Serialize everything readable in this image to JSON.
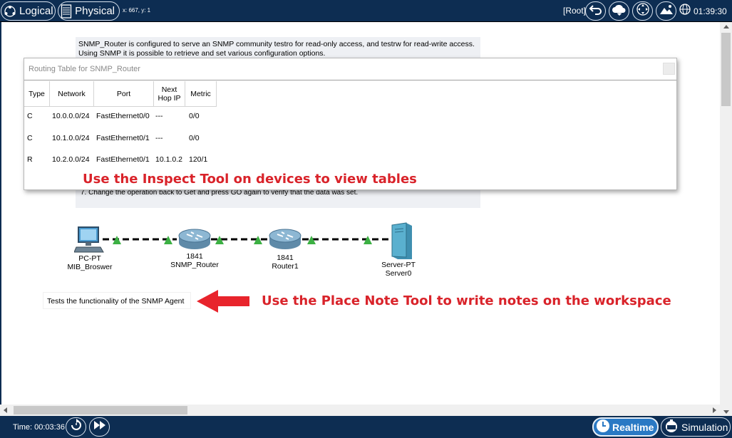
{
  "topbar": {
    "logical_label": "Logical",
    "physical_label": "Physical",
    "coords": "x: 667, y: 1",
    "root_label": "[Root]",
    "clock": "01:39:30"
  },
  "workspace": {
    "note_lines": [
      "SNMP_Router is configured to serve an SNMP community testro for read-only access, and testrw for read-write access.",
      "Using SNMP it is possible to retrieve and set various configuration options."
    ],
    "note_last_line": "7. Change the operation back to Get and press GO again to verify that the data was set.",
    "routing_window": {
      "title": "Routing Table for SNMP_Router",
      "headers": [
        "Type",
        "Network",
        "Port",
        "Next Hop IP",
        "Metric"
      ],
      "rows": [
        {
          "type": "C",
          "network": "10.0.0.0/24",
          "port": "FastEthernet0/0",
          "next_hop": "---",
          "metric": "0/0"
        },
        {
          "type": "C",
          "network": "10.1.0.0/24",
          "port": "FastEthernet0/1",
          "next_hop": "---",
          "metric": "0/0"
        },
        {
          "type": "R",
          "network": "10.2.0.0/24",
          "port": "FastEthernet0/1",
          "next_hop": "10.1.0.2",
          "metric": "120/1"
        }
      ],
      "inspect_note": "Use the Inspect Tool on devices to view tables"
    },
    "devices": [
      {
        "model": "PC-PT",
        "name": "MIB_Broswer"
      },
      {
        "model": "1841",
        "name": "SNMP_Router"
      },
      {
        "model": "1841",
        "name": "Router1"
      },
      {
        "model": "Server-PT",
        "name": "Server0"
      }
    ],
    "small_note": "Tests the functionality of the SNMP Agent",
    "place_note": "Use the Place Note Tool to write notes on the workspace"
  },
  "bottombar": {
    "time_label": "Time: 00:03:36",
    "realtime_label": "Realtime",
    "simulation_label": "Simulation"
  },
  "colors": {
    "bar_bg": "#0d2d52",
    "accent_blue": "#2a79c4",
    "annotation_red": "#d9232a",
    "link_green": "#3cb043"
  }
}
